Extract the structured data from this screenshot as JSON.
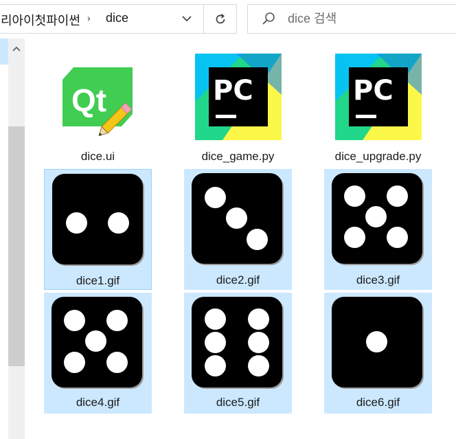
{
  "address_bar": {
    "prev_folder": "리아이첫파이썬",
    "separator": "›",
    "current_folder": "dice"
  },
  "search": {
    "placeholder": "dice 검색",
    "value": ""
  },
  "files": [
    {
      "name": "dice.ui",
      "icon": "qt-designer-icon",
      "selected": false
    },
    {
      "name": "dice_game.py",
      "icon": "pycharm-icon",
      "selected": false
    },
    {
      "name": "dice_upgrade.py",
      "icon": "pycharm-icon",
      "selected": false
    },
    {
      "name": "dice1.gif",
      "icon": "dice-face-2-icon",
      "selected": true,
      "focused": true
    },
    {
      "name": "dice2.gif",
      "icon": "dice-face-3-icon",
      "selected": true
    },
    {
      "name": "dice3.gif",
      "icon": "dice-face-5-icon",
      "selected": true
    },
    {
      "name": "dice4.gif",
      "icon": "dice-face-5-icon",
      "selected": true
    },
    {
      "name": "dice5.gif",
      "icon": "dice-face-6-icon",
      "selected": true
    },
    {
      "name": "dice6.gif",
      "icon": "dice-face-1-icon",
      "selected": true
    }
  ],
  "colors": {
    "selection": "#cce8ff",
    "focus_border": "#99d1ff",
    "qt_green": "#41cd52",
    "pycharm_teal": "#21d789",
    "pycharm_yellow": "#fcf84a"
  }
}
